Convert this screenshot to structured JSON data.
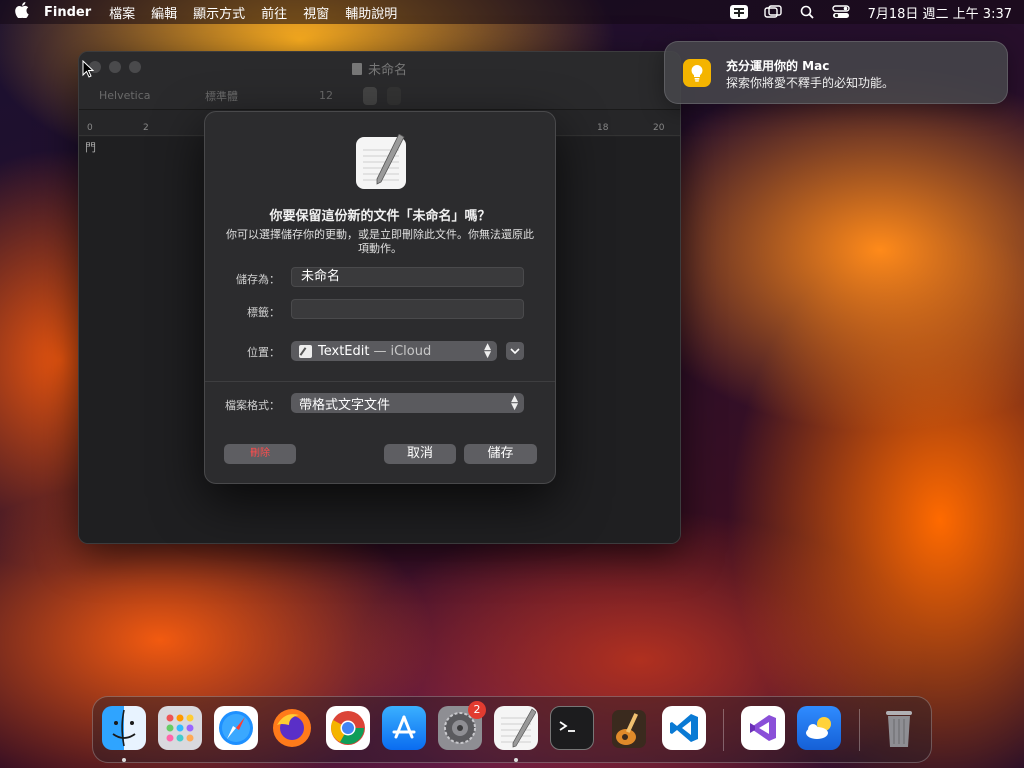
{
  "menubar": {
    "app_name": "Finder",
    "menus": [
      "檔案",
      "編輯",
      "顯示方式",
      "前往",
      "視窗",
      "輔助說明"
    ],
    "clock": "7月18日 週二 上午 3:37",
    "status_icons": [
      "input-method-icon",
      "screen-mirroring-icon",
      "spotlight-icon",
      "control-center-icon"
    ]
  },
  "textedit": {
    "window_title": "未命名",
    "toolbar": {
      "font_family": "Helvetica",
      "font_style": "標準體",
      "font_size": "12"
    },
    "ruler_ticks": [
      "0",
      "2",
      "18",
      "20"
    ],
    "content_mark": "門"
  },
  "save_dialog": {
    "title": "你要保留這份新的文件「未命名」嗎？",
    "message": "你可以選擇儲存你的更動，或是立即刪除此文件。你無法還原此項動作。",
    "save_as_label": "儲存為：",
    "save_as_value": "未命名",
    "tags_label": "標籤：",
    "tags_value": "",
    "location_label": "位置：",
    "location_app": "TextEdit",
    "location_sep": "—",
    "location_service": "iCloud",
    "format_label": "檔案格式：",
    "format_value": "帶格式文字文件",
    "delete_label": "刪除",
    "cancel_label": "取消",
    "save_label": "儲存"
  },
  "notification": {
    "title": "充分運用你的 Mac",
    "body": "探索你將愛不釋手的必知功能。"
  },
  "dock": {
    "items": [
      {
        "name": "finder",
        "running": true
      },
      {
        "name": "launchpad",
        "running": false
      },
      {
        "name": "safari",
        "running": false
      },
      {
        "name": "firefox",
        "running": false
      },
      {
        "name": "chrome",
        "running": false
      },
      {
        "name": "app-store",
        "running": false
      },
      {
        "name": "system-settings",
        "running": false,
        "badge": "2"
      },
      {
        "name": "textedit",
        "running": true
      },
      {
        "name": "terminal",
        "running": false
      },
      {
        "name": "garageband",
        "running": false
      },
      {
        "name": "vscode",
        "running": false
      },
      {
        "name": "visual-studio",
        "running": false
      },
      {
        "name": "weather",
        "running": false
      },
      {
        "name": "trash",
        "running": false
      }
    ]
  },
  "colors": {
    "accent_delete": "#ff4d4d",
    "badge": "#e23b30",
    "notif_icon": "#f4b400"
  }
}
